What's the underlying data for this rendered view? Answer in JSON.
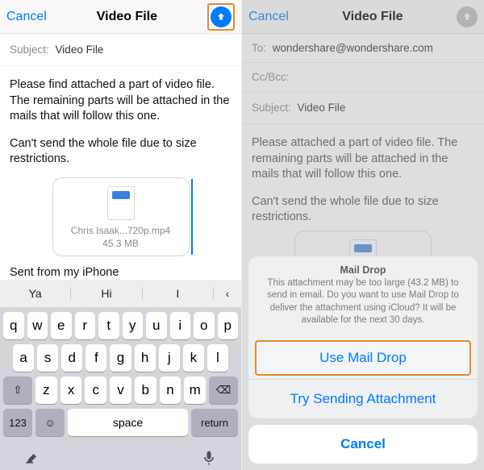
{
  "left": {
    "nav": {
      "cancel": "Cancel",
      "title": "Video File"
    },
    "subject": {
      "label": "Subject:",
      "value": "Video File"
    },
    "body": {
      "p1": "Please find attached a part of video file. The remaining parts will be attached in the mails that will follow this one.",
      "p2": "Can't send the whole file due to size restrictions."
    },
    "attachment": {
      "name": "Chris Isaak...720p.mp4",
      "size": "45.3 MB"
    },
    "signature": "Sent from my iPhone",
    "suggestions": [
      "Ya",
      "Hi",
      "I"
    ],
    "keyboard": {
      "row1": [
        "q",
        "w",
        "e",
        "r",
        "t",
        "y",
        "u",
        "i",
        "o",
        "p"
      ],
      "row2": [
        "a",
        "s",
        "d",
        "f",
        "g",
        "h",
        "j",
        "k",
        "l"
      ],
      "row3": [
        "z",
        "x",
        "c",
        "v",
        "b",
        "n",
        "m"
      ],
      "num": "123",
      "space": "space",
      "return": "return"
    }
  },
  "right": {
    "nav": {
      "cancel": "Cancel",
      "title": "Video File"
    },
    "to": {
      "label": "To:",
      "value": "wondershare@wondershare.com"
    },
    "cc": {
      "label": "Cc/Bcc:"
    },
    "subject": {
      "label": "Subject:",
      "value": "Video File"
    },
    "body": {
      "p1": "Please attached a part of video file. The remaining parts will be attached in the mails that will follow this one.",
      "p2": "Can't send the whole file due to size restrictions."
    },
    "sheet": {
      "title": "Mail Drop",
      "message": "This attachment may be too large (43.2 MB) to send in email. Do you want to use Mail Drop to deliver the attachment using iCloud? It will be available for the next 30 days.",
      "use": "Use Mail Drop",
      "try": "Try Sending Attachment",
      "cancel": "Cancel"
    }
  }
}
